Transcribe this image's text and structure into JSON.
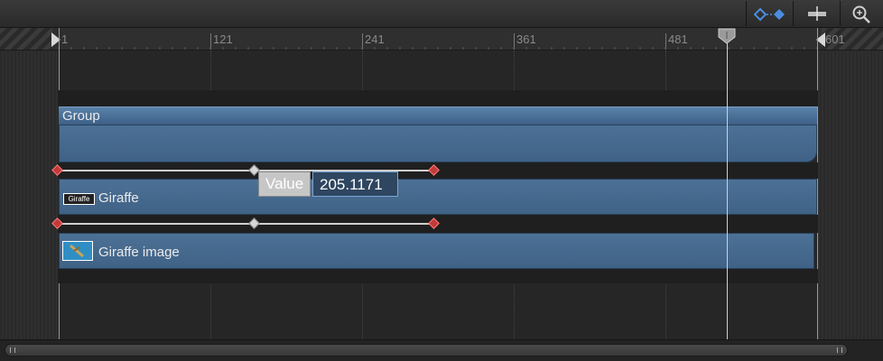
{
  "ruler": {
    "ticks": [
      "1",
      "121",
      "241",
      "361",
      "481",
      "601"
    ]
  },
  "tracks": {
    "group": {
      "label": "Group"
    },
    "giraffe": {
      "label": "Giraffe",
      "thumb_text": "Giraffe"
    },
    "giraffe_image": {
      "label": "Giraffe image"
    }
  },
  "value_editor": {
    "label": "Value",
    "value": "205.1171"
  },
  "icons": {
    "keyframe_toggle": "keyframe-diamonds-icon",
    "snap": "snapping-icon",
    "zoom": "zoom-icon"
  },
  "colors": {
    "track_blue": "#4d7196",
    "keyframe_red": "#c23a3a",
    "playhead": "#d0d0d0"
  }
}
